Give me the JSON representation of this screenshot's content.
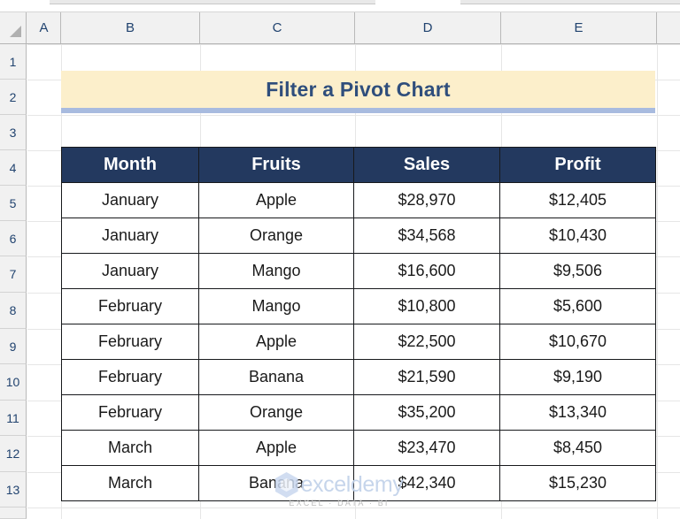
{
  "app": {
    "type": "spreadsheet",
    "select_all_icon": "select-all-triangle-icon"
  },
  "columns": {
    "headers": [
      "A",
      "B",
      "C",
      "D",
      "E"
    ],
    "widths": [
      38,
      157,
      175,
      165,
      176
    ],
    "partial_last": true
  },
  "rows": {
    "headers": [
      "1",
      "2",
      "3",
      "4",
      "5",
      "6",
      "7",
      "8",
      "9",
      "10",
      "11",
      "12",
      "13"
    ]
  },
  "banner": {
    "title": "Filter a Pivot Chart",
    "background_color": "#FCEFCB",
    "text_color": "#2F4E7C",
    "underline_color": "#A8BBDF"
  },
  "table": {
    "header_background": "#23395F",
    "header_text_color": "#FFFFFF",
    "border_color": "#17191C",
    "columns": [
      "Month",
      "Fruits",
      "Sales",
      "Profit"
    ],
    "rows": [
      {
        "month": "January",
        "fruits": "Apple",
        "sales": "$28,970",
        "profit": "$12,405"
      },
      {
        "month": "January",
        "fruits": "Orange",
        "sales": "$34,568",
        "profit": "$10,430"
      },
      {
        "month": "January",
        "fruits": "Mango",
        "sales": "$16,600",
        "profit": "$9,506"
      },
      {
        "month": "February",
        "fruits": "Mango",
        "sales": "$10,800",
        "profit": "$5,600"
      },
      {
        "month": "February",
        "fruits": "Apple",
        "sales": "$22,500",
        "profit": "$10,670"
      },
      {
        "month": "February",
        "fruits": "Banana",
        "sales": "$21,590",
        "profit": "$9,190"
      },
      {
        "month": "February",
        "fruits": "Orange",
        "sales": "$35,200",
        "profit": "$13,340"
      },
      {
        "month": "March",
        "fruits": "Apple",
        "sales": "$23,470",
        "profit": "$8,450"
      },
      {
        "month": "March",
        "fruits": "Banana",
        "sales": "$42,340",
        "profit": "$15,230"
      }
    ]
  },
  "watermark": {
    "name": "exceldemy",
    "tagline": "EXCEL · DATA · BI",
    "logo_icon": "hexagon-logo-icon"
  }
}
